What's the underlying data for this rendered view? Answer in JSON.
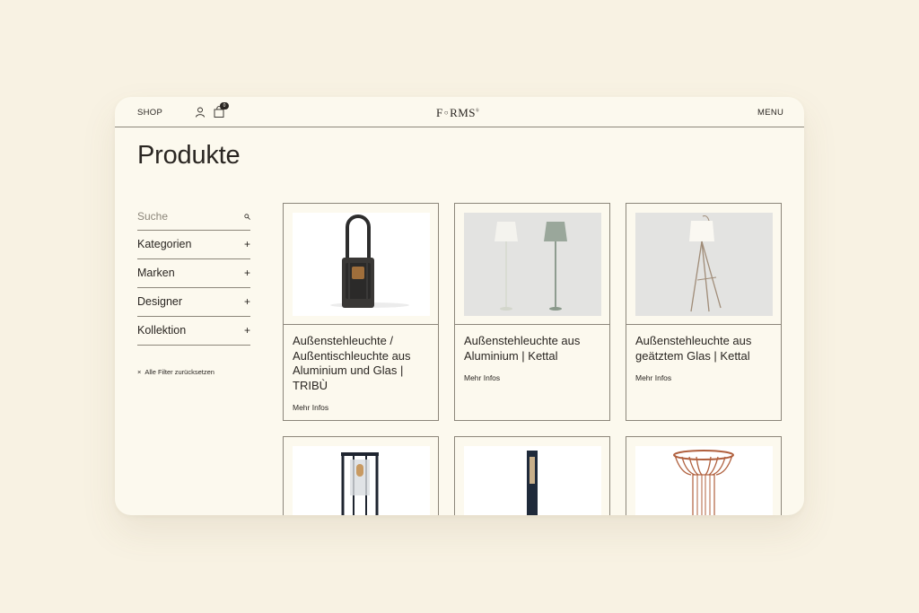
{
  "header": {
    "shop_label": "SHOP",
    "logo_text_1": "F",
    "logo_text_o": "○",
    "logo_text_2": "RMS",
    "logo_tm": "®",
    "menu_label": "MENU",
    "cart_count": "0"
  },
  "page": {
    "title": "Produkte"
  },
  "sidebar": {
    "search_placeholder": "Suche",
    "filters": [
      {
        "label": "Kategorien",
        "icon": "+"
      },
      {
        "label": "Marken",
        "icon": "+"
      },
      {
        "label": "Designer",
        "icon": "+"
      },
      {
        "label": "Kollektion",
        "icon": "+"
      }
    ],
    "reset_icon": "×",
    "reset_label": "Alle Filter zurücksetzen"
  },
  "products": [
    {
      "title": "Außenstehleuchte / Außentischleuchte aus Aluminium und Glas | TRIBÙ",
      "more": "Mehr Infos"
    },
    {
      "title": "Außenstehleuchte aus Aluminium | Kettal",
      "more": "Mehr Infos"
    },
    {
      "title": "Außenstehleuchte aus geätztem Glas | Kettal",
      "more": "Mehr Infos"
    }
  ],
  "colors": {
    "background": "#f8f2e3",
    "panel": "#fcf9ee",
    "text": "#2a2622",
    "line": "#8c867a"
  }
}
